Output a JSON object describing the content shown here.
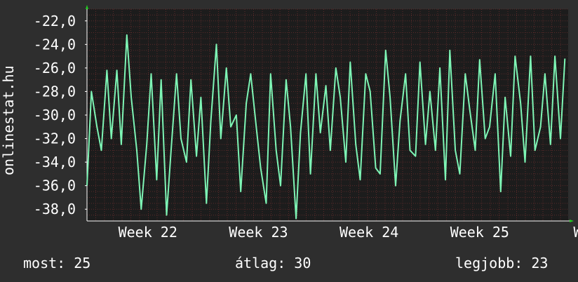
{
  "colors": {
    "background": "#2e2e2e",
    "plot": "#1c1c1c",
    "line": "#7ef5b5",
    "grid": "#5a2a2a",
    "axis": "#ffffff",
    "arrow": "#22cc22"
  },
  "side_label": "onlinestat.hu",
  "stats": {
    "most": "most: 25",
    "atlag": "átlag: 30",
    "legjobb": "legjobb: 23"
  },
  "chart_data": {
    "type": "line",
    "title": "",
    "xlabel": "",
    "ylabel": "onlinestat.hu",
    "ylim": [
      -39,
      -21
    ],
    "grid": true,
    "yticks": [
      {
        "value": -22,
        "label": "-22,0"
      },
      {
        "value": -24,
        "label": "-24,0"
      },
      {
        "value": -26,
        "label": "-26,0"
      },
      {
        "value": -28,
        "label": "-28,0"
      },
      {
        "value": -30,
        "label": "-30,0"
      },
      {
        "value": -32,
        "label": "-32,0"
      },
      {
        "value": -34,
        "label": "-34,0"
      },
      {
        "value": -36,
        "label": "-36,0"
      },
      {
        "value": -38,
        "label": "-38,0"
      }
    ],
    "xticks": [
      {
        "value": 0.55,
        "label": "Week 22"
      },
      {
        "value": 1.55,
        "label": "Week 23"
      },
      {
        "value": 2.55,
        "label": "Week 24"
      },
      {
        "value": 3.55,
        "label": "Week 25"
      },
      {
        "value": 4.55,
        "label": "Week"
      }
    ],
    "xlim": [
      0,
      4.35
    ],
    "series": [
      {
        "name": "",
        "x": [
          0,
          0.04,
          0.09,
          0.13,
          0.18,
          0.22,
          0.27,
          0.31,
          0.36,
          0.4,
          0.45,
          0.49,
          0.54,
          0.58,
          0.63,
          0.67,
          0.72,
          0.76,
          0.81,
          0.85,
          0.9,
          0.94,
          0.99,
          1.03,
          1.08,
          1.12,
          1.17,
          1.21,
          1.26,
          1.3,
          1.35,
          1.39,
          1.44,
          1.48,
          1.53,
          1.57,
          1.62,
          1.66,
          1.71,
          1.75,
          1.8,
          1.84,
          1.89,
          1.93,
          1.98,
          2.02,
          2.07,
          2.11,
          2.16,
          2.2,
          2.25,
          2.29,
          2.34,
          2.38,
          2.43,
          2.47,
          2.52,
          2.56,
          2.61,
          2.65,
          2.7,
          2.74,
          2.79,
          2.83,
          2.88,
          2.92,
          2.97,
          3.01,
          3.06,
          3.1,
          3.15,
          3.19,
          3.24,
          3.28,
          3.33,
          3.37,
          3.42,
          3.46,
          3.51,
          3.55,
          3.6,
          3.64,
          3.69,
          3.74,
          3.78,
          3.83,
          3.87,
          3.92,
          3.96,
          4.01,
          4.05,
          4.1,
          4.14,
          4.19,
          4.23,
          4.28,
          4.32
        ],
        "values": [
          -36,
          -28,
          -31,
          -33,
          -26.2,
          -32,
          -26.2,
          -32.5,
          -23.2,
          -28.5,
          -33,
          -38,
          -32.5,
          -26.5,
          -35.5,
          -27,
          -38.5,
          -33,
          -26.5,
          -32,
          -34,
          -27,
          -33.5,
          -28.5,
          -37.5,
          -30.5,
          -24,
          -32,
          -26,
          -31,
          -30,
          -36.5,
          -29,
          -26.5,
          -31,
          -34.5,
          -37.5,
          -26.5,
          -33,
          -36,
          -27,
          -31,
          -38.8,
          -31.5,
          -26.5,
          -35,
          -26.5,
          -31.5,
          -27.5,
          -33,
          -26,
          -28.5,
          -34,
          -25.5,
          -32.5,
          -35.5,
          -26.5,
          -28,
          -34.5,
          -35,
          -24.5,
          -28.5,
          -36,
          -30.5,
          -26.5,
          -33,
          -33.5,
          -25.5,
          -32.5,
          -28,
          -33,
          -26,
          -35.5,
          -24.5,
          -33,
          -35,
          -26.5,
          -29.5,
          -33,
          -25.3,
          -32,
          -31,
          -26.5,
          -36.5,
          -28.5,
          -33.5,
          -25,
          -29,
          -34,
          -25,
          -33,
          -31,
          -26.5,
          -32.5,
          -25,
          -32,
          -25.2
        ]
      }
    ]
  }
}
